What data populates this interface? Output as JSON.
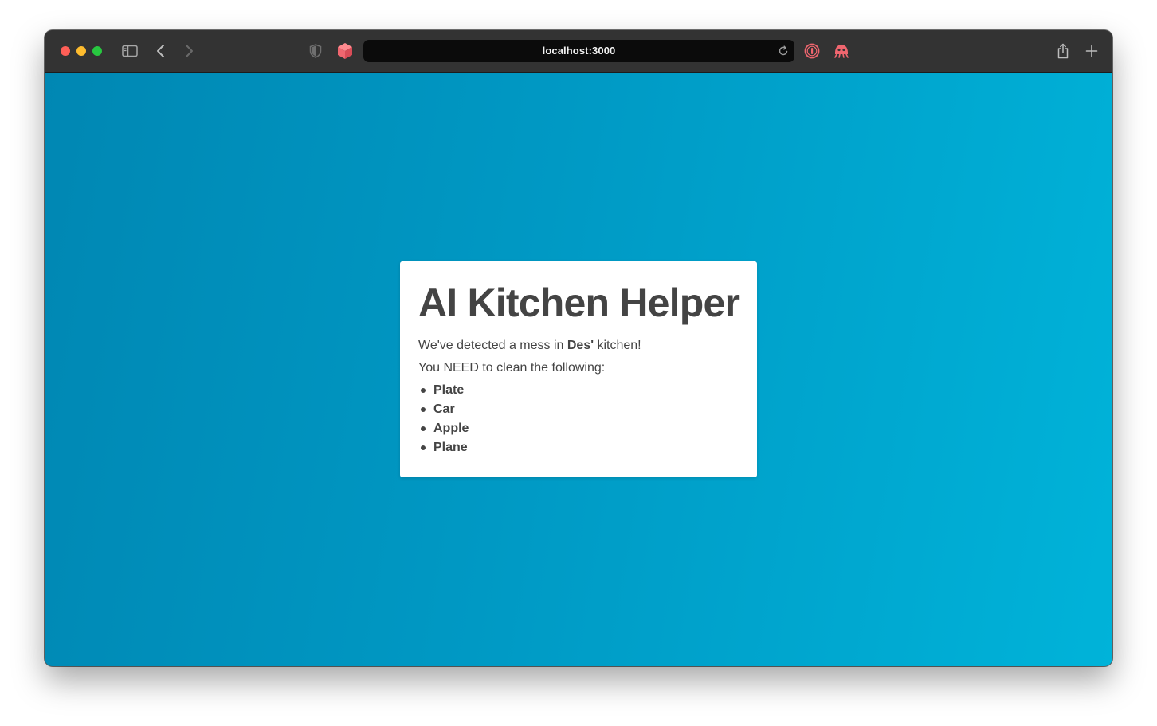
{
  "browser": {
    "url": "localhost:3000",
    "icons": {
      "sidebar": "sidebar-icon",
      "back": "chevron-left-icon",
      "forward": "chevron-right-icon",
      "privacy": "shield-icon",
      "extension": "box-icon",
      "password_manager": "onepassword-icon",
      "extension_2": "ghost-icon",
      "reload": "reload-icon",
      "share": "share-icon",
      "new_tab": "plus-icon"
    },
    "colors": {
      "toolbar": "#333333",
      "address_bar": "#0b0b0b",
      "extension_accent": "#f0666f"
    }
  },
  "page": {
    "title": "AI Kitchen Helper",
    "detected_prefix": "We've detected a mess in ",
    "owner": "Des'",
    "detected_suffix": " kitchen!",
    "instruction": "You NEED to clean the following:",
    "items": [
      "Plate",
      "Car",
      "Apple",
      "Plane"
    ],
    "colors": {
      "background_start": "#0087b3",
      "background_end": "#00b3d9",
      "card": "#ffffff",
      "text": "#444444"
    }
  }
}
